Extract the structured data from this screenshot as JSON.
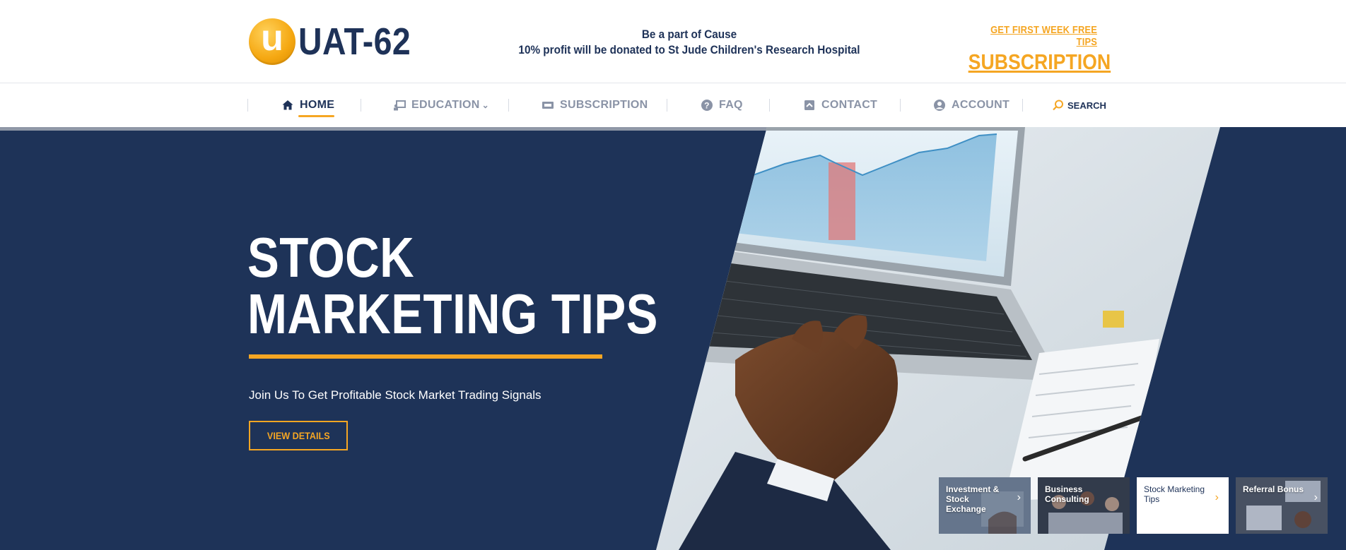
{
  "header": {
    "logo_letter": "u",
    "logo_text": "UAT-62",
    "cause_line1": "Be a part of Cause",
    "cause_line2": "10% profit will be donated to St Jude Children's Research Hospital",
    "subscription_teaser": "GET FIRST WEEK FREE TIPS",
    "subscription_label": "SUBSCRIPTION"
  },
  "nav": {
    "items": [
      {
        "label": "HOME",
        "icon": "home-icon",
        "active": true
      },
      {
        "label": "EDUCATION",
        "icon": "education-icon",
        "has_dropdown": true
      },
      {
        "label": "SUBSCRIPTION",
        "icon": "ticket-icon"
      },
      {
        "label": "FAQ",
        "icon": "question-icon"
      },
      {
        "label": "CONTACT",
        "icon": "contact-icon"
      },
      {
        "label": "ACCOUNT",
        "icon": "user-icon"
      }
    ],
    "search_label": "SEARCH"
  },
  "hero": {
    "title_line1": "STOCK",
    "title_line2": "MARKETING TIPS",
    "subtitle": "Join Us To Get Profitable Stock Market Trading Signals",
    "button_label": "VIEW DETAILS"
  },
  "thumbnails": [
    {
      "label": "Investment & Stock Exchange",
      "active": false
    },
    {
      "label": "Business Consulting",
      "active": false
    },
    {
      "label": "Stock Marketing Tips",
      "active": true
    },
    {
      "label": "Referral Bonus",
      "active": false
    }
  ],
  "colors": {
    "navy": "#1e3358",
    "accent": "#f5a623",
    "nav_inactive": "#8a93a6"
  }
}
